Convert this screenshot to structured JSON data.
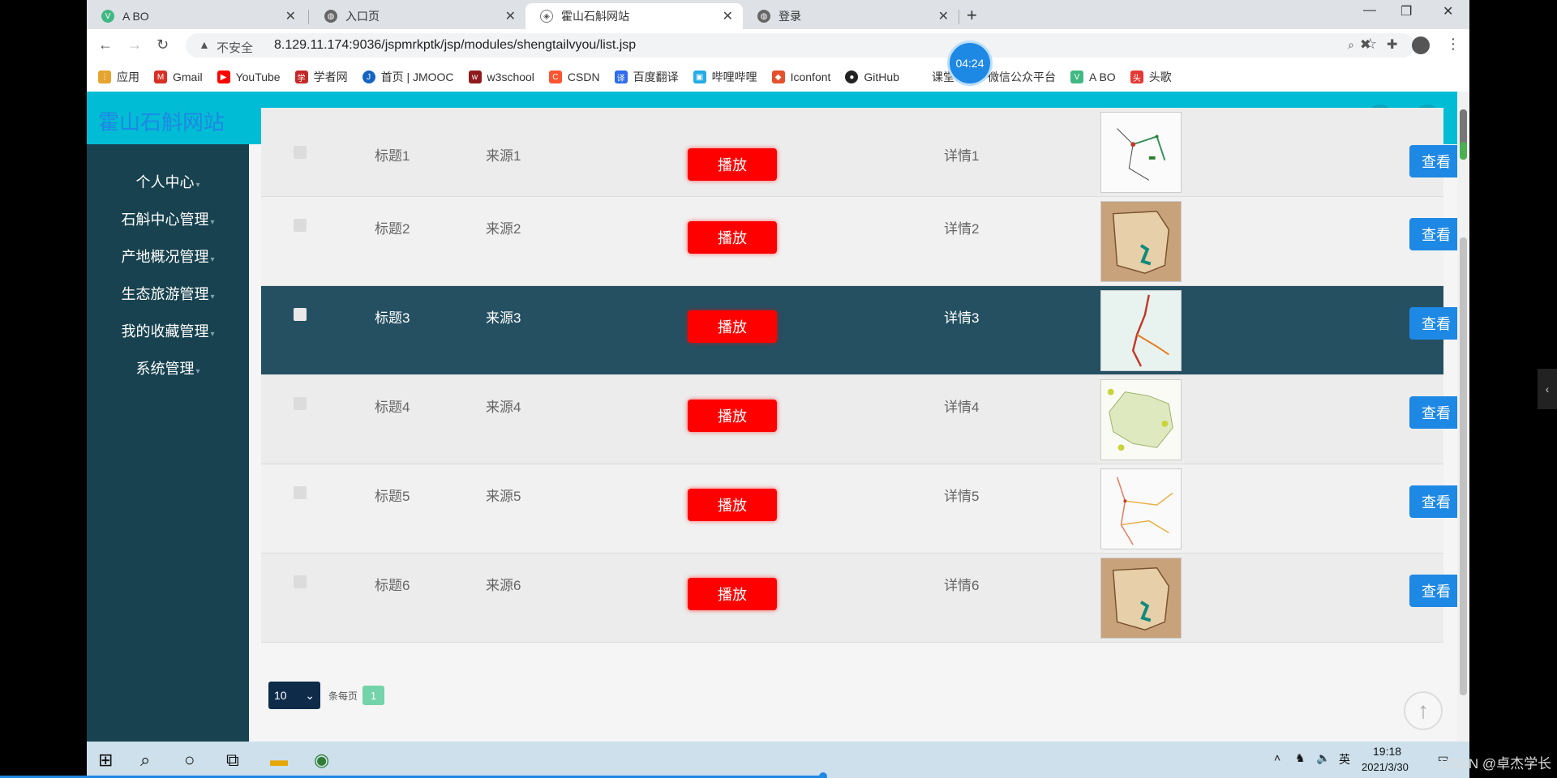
{
  "browser": {
    "tabs": [
      {
        "label": "A BO"
      },
      {
        "label": "入口页"
      },
      {
        "label": "霍山石斛网站"
      },
      {
        "label": "登录"
      }
    ],
    "address": {
      "insecure_label": "不安全",
      "url": "8.129.11.174:9036/jspmrkptk/jsp/modules/shengtailvyou/list.jsp"
    },
    "bookmarks": [
      {
        "label": "应用",
        "icon": "apps-grid-icon"
      },
      {
        "label": "Gmail",
        "icon": "gmail-icon"
      },
      {
        "label": "YouTube",
        "icon": "youtube-icon"
      },
      {
        "label": "学者网",
        "icon": "scholarmate-icon"
      },
      {
        "label": "首页 | JMOOC",
        "icon": "jmooc-icon"
      },
      {
        "label": "w3school",
        "icon": "w3school-icon"
      },
      {
        "label": "CSDN",
        "icon": "csdn-icon"
      },
      {
        "label": "百度翻译",
        "icon": "baidu-translate-icon"
      },
      {
        "label": "哔哩哔哩",
        "icon": "bilibili-icon"
      },
      {
        "label": "Iconfont",
        "icon": "iconfont-icon"
      },
      {
        "label": "GitHub",
        "icon": "github-icon"
      },
      {
        "label": "课堂",
        "icon": "classroom-icon"
      },
      {
        "label": "微信公众平台",
        "icon": "wechat-icon"
      },
      {
        "label": "A BO",
        "icon": "vue-icon"
      },
      {
        "label": "头歌",
        "icon": "toutiao-icon"
      }
    ]
  },
  "timer": "04:24",
  "site": {
    "title": "霍山石斛网站"
  },
  "sidebar": {
    "items": [
      {
        "label": "个人中心"
      },
      {
        "label": "石斛中心管理"
      },
      {
        "label": "产地概况管理"
      },
      {
        "label": "生态旅游管理"
      },
      {
        "label": "我的收藏管理"
      },
      {
        "label": "系统管理"
      }
    ]
  },
  "table": {
    "play_label": "播放",
    "view_label": "查看",
    "rows": [
      {
        "title": "标题1",
        "source": "来源1",
        "detail": "详情1"
      },
      {
        "title": "标题2",
        "source": "来源2",
        "detail": "详情2"
      },
      {
        "title": "标题3",
        "source": "来源3",
        "detail": "详情3"
      },
      {
        "title": "标题4",
        "source": "来源4",
        "detail": "详情4"
      },
      {
        "title": "标题5",
        "source": "来源5",
        "detail": "详情5"
      },
      {
        "title": "标题6",
        "source": "来源6",
        "detail": "详情6"
      }
    ]
  },
  "pager": {
    "page_size": "10",
    "per_page_label": "条每页",
    "current_page": "1"
  },
  "taskbar": {
    "ime": "英",
    "time": "19:18",
    "date": "2021/3/30"
  },
  "watermark": "CSDN @卓杰学长",
  "colors": {
    "header": "#00bcd4",
    "sidebar": "#18424f",
    "highlight_row": "#255062",
    "play_button": "#ff0000",
    "view_button": "#1e88e5",
    "pager_current": "#73d3a9"
  }
}
